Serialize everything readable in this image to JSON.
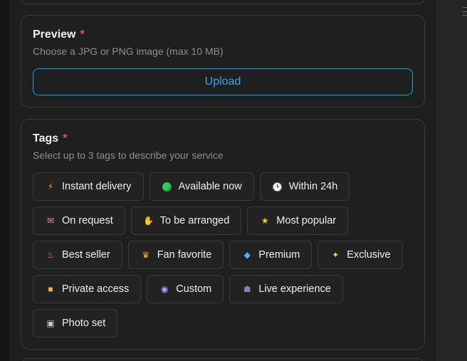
{
  "preview": {
    "title": "Preview",
    "required_mark": "*",
    "subtitle": "Choose a JPG or PNG image (max 10 MB)",
    "upload_label": "Upload"
  },
  "tags": {
    "title": "Tags",
    "required_mark": "*",
    "subtitle": "Select up to 3 tags to describe your service",
    "items": [
      {
        "label": "Instant delivery",
        "icon": "lightning-icon"
      },
      {
        "label": "Available now",
        "icon": "green-dot-icon"
      },
      {
        "label": "Within 24h",
        "icon": "clock-icon"
      },
      {
        "label": "On request",
        "icon": "mailbox-icon"
      },
      {
        "label": "To be arranged",
        "icon": "handshake-icon"
      },
      {
        "label": "Most popular",
        "icon": "star-icon"
      },
      {
        "label": "Best seller",
        "icon": "fire-icon"
      },
      {
        "label": "Fan favorite",
        "icon": "crown-icon"
      },
      {
        "label": "Premium",
        "icon": "gem-icon"
      },
      {
        "label": "Exclusive",
        "icon": "sparkles-icon"
      },
      {
        "label": "Private access",
        "icon": "lock-icon"
      },
      {
        "label": "Custom",
        "icon": "eye-icon"
      },
      {
        "label": "Live experience",
        "icon": "mask-icon"
      },
      {
        "label": "Photo set",
        "icon": "camera-icon"
      }
    ]
  },
  "colors": {
    "accent": "#1da1e2",
    "required": "#ef4f5f",
    "card_border": "#3a3a3b"
  }
}
